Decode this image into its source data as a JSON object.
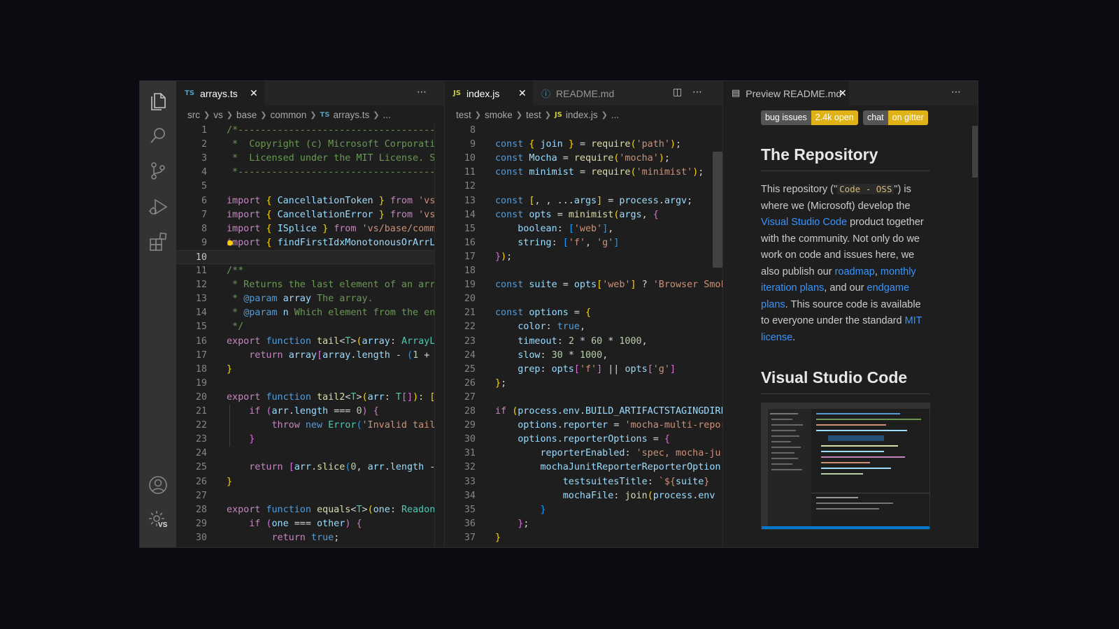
{
  "editor1": {
    "tab": {
      "icon": "TS",
      "name": "arrays.ts"
    },
    "breadcrumb": [
      "src",
      "vs",
      "base",
      "common",
      "arrays.ts",
      "..."
    ],
    "breadcrumb_file_icon": "TS"
  },
  "editor2": {
    "tabs": [
      {
        "icon": "JS",
        "name": "index.js"
      },
      {
        "icon": "info-icon",
        "name": "README.md"
      }
    ],
    "breadcrumb": [
      "test",
      "smoke",
      "test",
      "index.js",
      "..."
    ],
    "breadcrumb_file_icon": "JS"
  },
  "preview": {
    "tab": "Preview README.md",
    "badges": [
      {
        "left": "bug",
        "right": "issues",
        "value": "2.4k open"
      },
      {
        "left": "chat",
        "right": "on gitter"
      }
    ],
    "heading1": "The Repository",
    "para": {
      "t1": "This repository (\"",
      "code": "Code - OSS",
      "t2": "\") is where we (Microsoft) develop the ",
      "link1": "Visual Studio Code",
      "t3": " product together with the community. Not only do we work on code and issues here, we also publish our ",
      "link2": "roadmap",
      "t4": ", ",
      "link3": "monthly iteration plans",
      "t5": ", and our ",
      "link4": "endgame plans",
      "t6": ". This source code is available to everyone under the standard ",
      "link5": "MIT license",
      "t7": "."
    },
    "heading2": "Visual Studio Code"
  },
  "activity_bar": [
    "files-icon",
    "search-icon",
    "source-control-icon",
    "run-debug-icon",
    "extensions-icon",
    "account-icon",
    "manage-gear-icon"
  ],
  "settings_badge": "VS",
  "colors": {
    "accent": "#007acc",
    "badge_yellow": "#dfb317",
    "link": "#3794ff"
  }
}
